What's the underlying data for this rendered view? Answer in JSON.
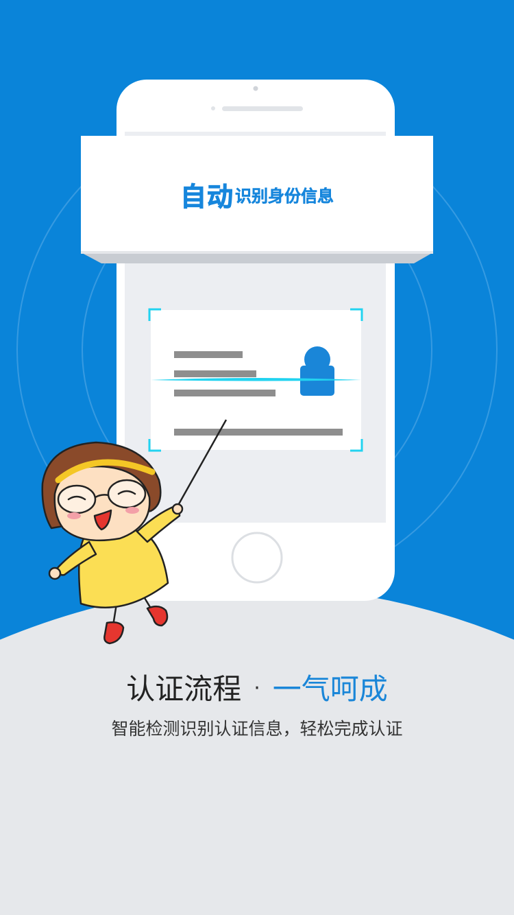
{
  "banner": {
    "title_big": "自动",
    "title_small": "识别身份信息"
  },
  "headline": {
    "part1": "认证流程",
    "separator": "·",
    "part2": "一气呵成"
  },
  "subtitle": "智能检测识别认证信息，轻松完成认证",
  "colors": {
    "background_blue": "#0a84d9",
    "ground_gray": "#e6e8eb",
    "accent_blue": "#1786dc",
    "scan_cyan": "#22d3f0"
  }
}
